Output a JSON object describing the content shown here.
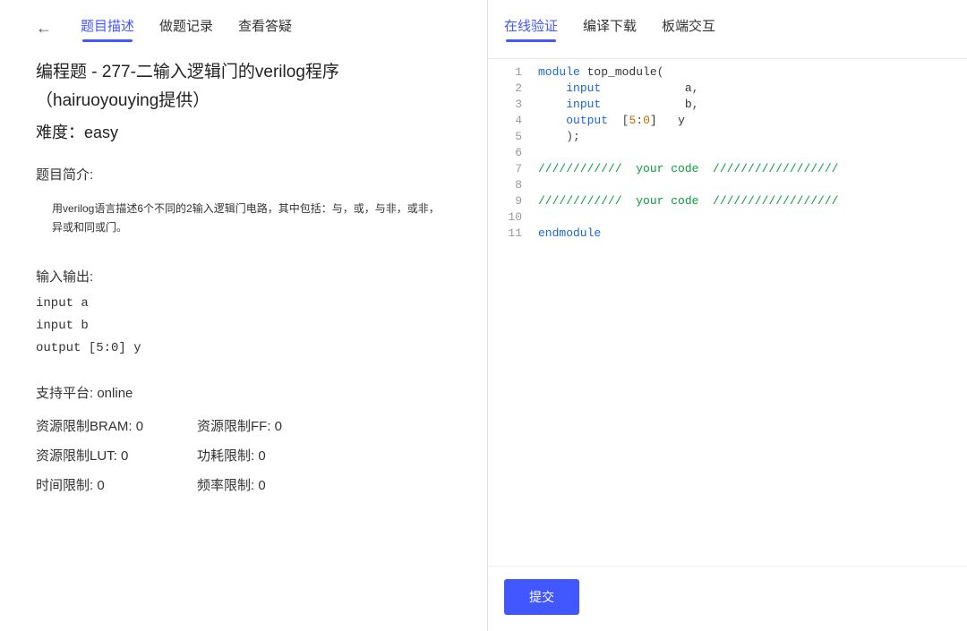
{
  "left": {
    "tabs": [
      {
        "label": "题目描述",
        "active": true
      },
      {
        "label": "做题记录",
        "active": false
      },
      {
        "label": "查看答疑",
        "active": false
      }
    ],
    "title": "编程题 - 277-二输入逻辑门的verilog程序（hairuoyouying提供）",
    "difficulty_label": "难度：",
    "difficulty_value": "easy",
    "intro_label": "题目简介:",
    "intro_text": "用verilog语言描述6个不同的2输入逻辑门电路，其中包括：与，或，与非，或非，异或和同或门。",
    "io_label": "输入输出:",
    "io_lines": [
      "input a",
      "input b",
      "output [5:0] y"
    ],
    "platform_label": "支持平台:",
    "platform_value": "online",
    "limits": [
      {
        "label": "资源限制BRAM:",
        "value": "0"
      },
      {
        "label": "资源限制FF:",
        "value": "0"
      },
      {
        "label": "资源限制LUT:",
        "value": "0"
      },
      {
        "label": "功耗限制:",
        "value": "0"
      },
      {
        "label": "时间限制:",
        "value": "0"
      },
      {
        "label": "频率限制:",
        "value": "0"
      }
    ]
  },
  "right": {
    "tabs": [
      {
        "label": "在线验证",
        "active": true
      },
      {
        "label": "编译下载",
        "active": false
      },
      {
        "label": "板端交互",
        "active": false
      }
    ],
    "code": {
      "line_count": 11,
      "tokens": [
        [
          {
            "t": "module",
            "c": "kw"
          },
          {
            "t": " top_module",
            "c": "ident"
          },
          {
            "t": "(",
            "c": "paren"
          }
        ],
        [
          {
            "t": "    ",
            "c": ""
          },
          {
            "t": "input",
            "c": "kw"
          },
          {
            "t": "            a",
            "c": "ident"
          },
          {
            "t": ",",
            "c": "paren"
          }
        ],
        [
          {
            "t": "    ",
            "c": ""
          },
          {
            "t": "input",
            "c": "kw"
          },
          {
            "t": "            b",
            "c": "ident"
          },
          {
            "t": ",",
            "c": "paren"
          }
        ],
        [
          {
            "t": "    ",
            "c": ""
          },
          {
            "t": "output",
            "c": "kw"
          },
          {
            "t": "  [",
            "c": "paren"
          },
          {
            "t": "5",
            "c": "num"
          },
          {
            "t": ":",
            "c": "paren"
          },
          {
            "t": "0",
            "c": "num"
          },
          {
            "t": "]   y",
            "c": "ident"
          }
        ],
        [
          {
            "t": "    );",
            "c": "paren"
          }
        ],
        [],
        [
          {
            "t": "////////////  your code  //////////////////",
            "c": "comment"
          }
        ],
        [],
        [
          {
            "t": "////////////  your code  //////////////////",
            "c": "comment"
          }
        ],
        [],
        [
          {
            "t": "endmodule",
            "c": "kw"
          }
        ]
      ]
    },
    "submit_label": "提交"
  }
}
